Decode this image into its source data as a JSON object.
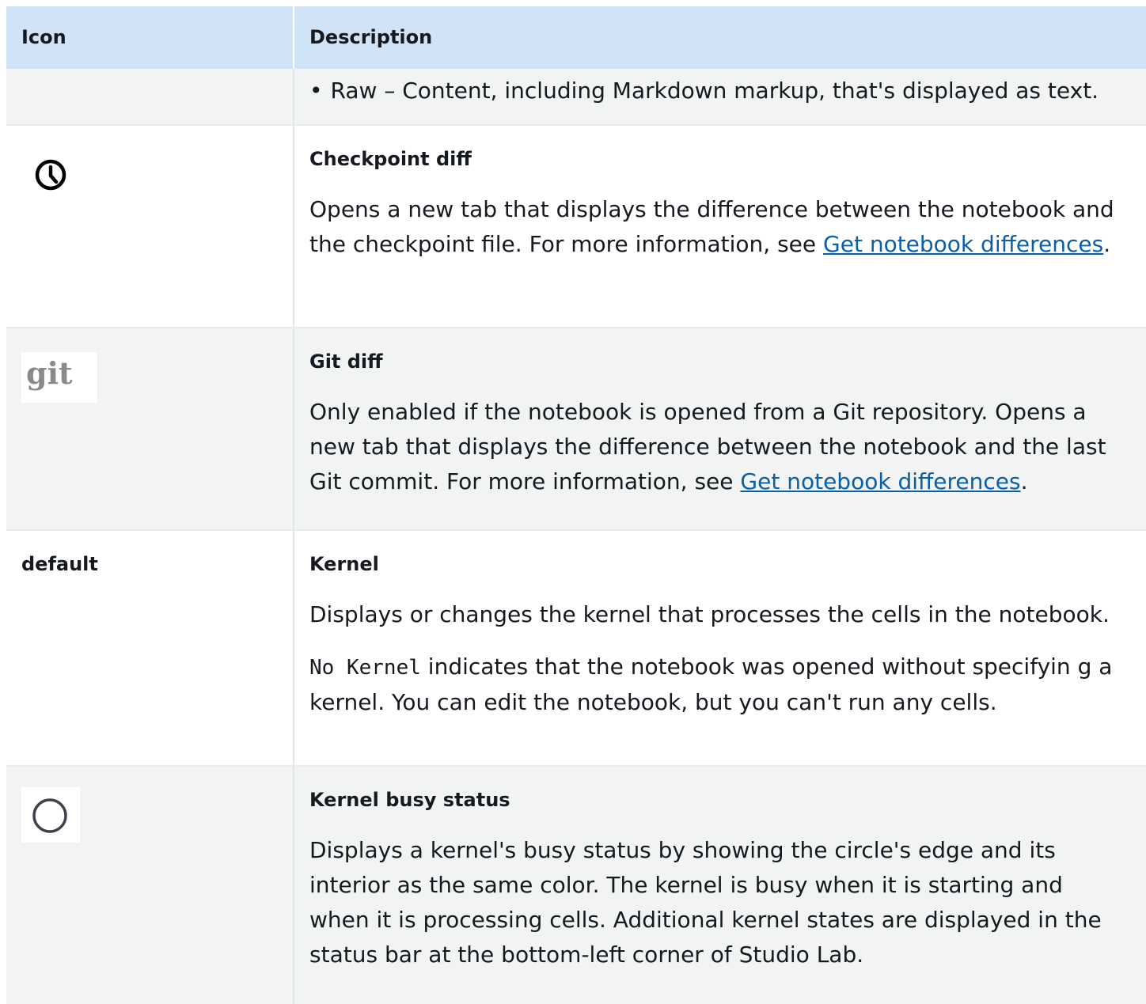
{
  "header": {
    "icon_col": "Icon",
    "desc_col": "Description"
  },
  "rows": [
    {
      "bullet": "Raw – Content, including Markdown markup, that's displayed as text."
    },
    {
      "icon": "clock-icon",
      "title": "Checkpoint diff",
      "text_before": "Opens a new tab that displays the difference between the notebook and the checkpoint file. For more information, see ",
      "link": "Get notebook differences",
      "text_after": "."
    },
    {
      "icon": "git-icon",
      "icon_text": "git",
      "title": "Git diff",
      "text_before": "Only enabled if the notebook is opened from a Git repository. Opens a new tab that displays the difference between the notebook and the last Git commit. For more information, see ",
      "link": "Get notebook differences",
      "text_after": "."
    },
    {
      "icon_text": "default",
      "title": "Kernel",
      "para1": "Displays or changes the kernel that processes the cells in the notebook.",
      "code": "No Kernel",
      "para2": " indicates that the notebook was opened without specifyin g a kernel. You can edit the notebook, but you can't run any cells."
    },
    {
      "icon": "circle-icon",
      "title": "Kernel busy status",
      "para1": "Displays a kernel's busy status by showing the circle's edge and its interior as the same color. The kernel is busy when it is starting and when it is processing cells. Additional kernel states are displayed in the status bar at the bottom-left corner of Studio Lab."
    }
  ],
  "colors": {
    "header_bg": "#d1e4f7",
    "alt_bg": "#f2f3f3",
    "link": "#0a5fa9"
  }
}
